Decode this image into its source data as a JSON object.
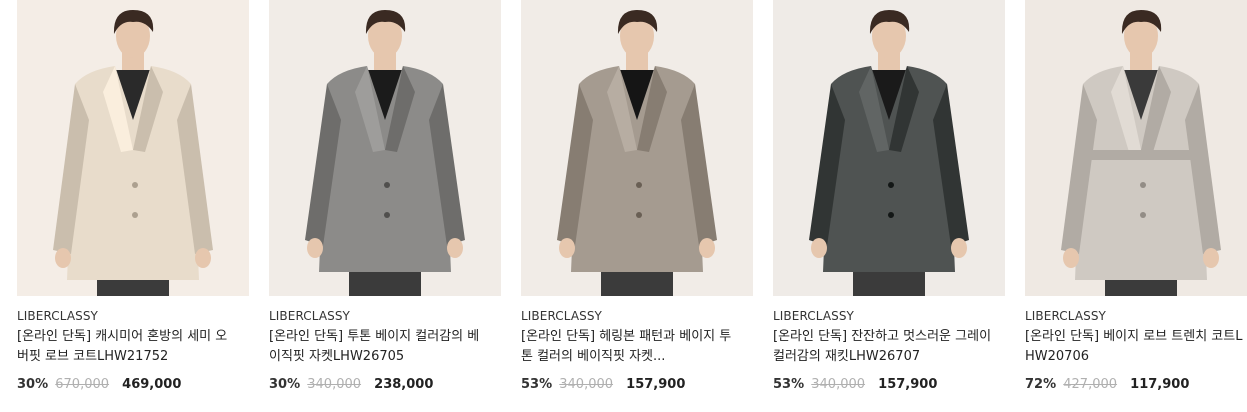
{
  "products": [
    {
      "brand": "LIBERCLASSY",
      "title": "[온라인 단독] 캐시미어 혼방의 세미 오버핏 로브 코트LHW21752",
      "discount": "30%",
      "original_price": "670,000",
      "sale_price": "469,000",
      "backdrop_color": "#f4ede6",
      "garment_color": "#e8dccb",
      "inner_color": "#2a2a2a",
      "garment_type": "long-coat"
    },
    {
      "brand": "LIBERCLASSY",
      "title": "[온라인 단독] 투톤 베이지 컬러감의 베이직핏 자켓LHW26705",
      "discount": "30%",
      "original_price": "340,000",
      "sale_price": "238,000",
      "backdrop_color": "#f1ece7",
      "garment_color": "#8c8b89",
      "inner_color": "#1b1b1b",
      "garment_type": "blazer"
    },
    {
      "brand": "LIBERCLASSY",
      "title": "[온라인 단독] 헤링본 패턴과 베이지 투톤 컬러의 베이직핏 자켓...",
      "discount": "53%",
      "original_price": "340,000",
      "sale_price": "157,900",
      "backdrop_color": "#f1ece7",
      "garment_color": "#a59b90",
      "inner_color": "#151515",
      "garment_type": "blazer"
    },
    {
      "brand": "LIBERCLASSY",
      "title": "[온라인 단독] 잔잔하고 멋스러운 그레이 컬러감의 재킷LHW26707",
      "discount": "53%",
      "original_price": "340,000",
      "sale_price": "157,900",
      "backdrop_color": "#efebe7",
      "garment_color": "#4f5352",
      "inner_color": "#1a1a1a",
      "garment_type": "blazer"
    },
    {
      "brand": "LIBERCLASSY",
      "title": "[온라인 단독] 베이지 로브 트렌치 코트LHW20706",
      "discount": "72%",
      "original_price": "427,000",
      "sale_price": "117,900",
      "backdrop_color": "#efe9e3",
      "garment_color": "#cfc9c2",
      "inner_color": "#3a3a3a",
      "garment_type": "trench"
    }
  ]
}
